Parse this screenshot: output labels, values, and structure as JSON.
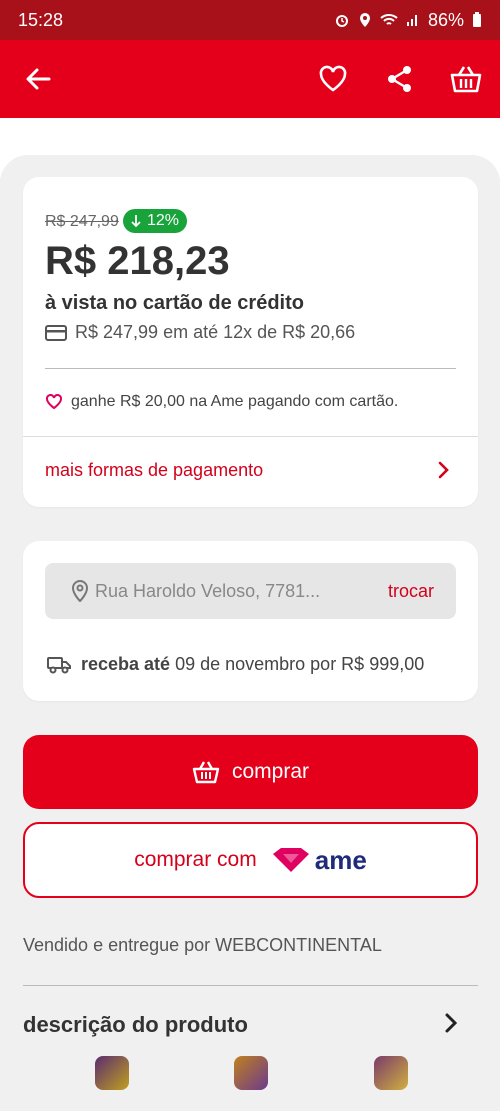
{
  "status_bar": {
    "time": "15:28",
    "battery": "86%",
    "icons": [
      "alarm-icon",
      "location-icon",
      "wifi-icon",
      "signal-icon",
      "battery-icon"
    ]
  },
  "app_bar": {
    "icons": [
      "back-arrow-icon",
      "heart-icon",
      "share-icon",
      "basket-icon"
    ],
    "background": "#e4001b"
  },
  "pricing": {
    "old_price": "R$ 247,99",
    "discount": "12%",
    "price": "R$ 218,23",
    "subtitle": "à vista no cartão de crédito",
    "installments": "R$ 247,99 em até 12x de R$ 20,66",
    "ame_cashback": "ganhe R$ 20,00 na Ame pagando com cartão.",
    "more_payment": "mais formas de pagamento"
  },
  "shipping": {
    "address": "Rua Haroldo Veloso, 7781...",
    "change_label": "trocar",
    "delivery_bold": "receba até",
    "delivery_text": "09 de novembro por R$ 999,00"
  },
  "actions": {
    "buy_label": "comprar",
    "buy_with_label": "comprar com",
    "ame_logo_text": "ame"
  },
  "seller": "Vendido e entregue por WEBCONTINENTAL",
  "description_title": "descrição do produto",
  "colors": {
    "accent": "#e4001b",
    "discount_badge": "#18a33b",
    "ame_pink": "#e0005f",
    "ame_navy": "#1f2b7a"
  }
}
